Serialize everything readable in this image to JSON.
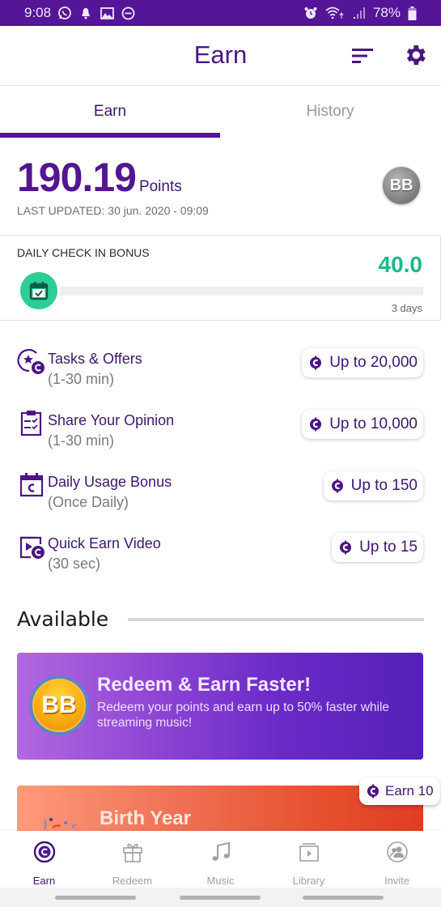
{
  "status_bar": {
    "time": "9:08",
    "battery": "78%",
    "left_icons": [
      "whatsapp-icon",
      "notification-bell-icon",
      "gallery-icon",
      "do-not-disturb-icon"
    ],
    "right_icons": [
      "alarm-icon",
      "wifi-icon",
      "signal-icon",
      "battery-icon"
    ]
  },
  "header": {
    "title": "Earn",
    "actions": [
      "filter-icon",
      "settings-gear-icon"
    ]
  },
  "tabs": [
    {
      "label": "Earn",
      "active": true
    },
    {
      "label": "History",
      "active": false
    }
  ],
  "points": {
    "value": "190.19",
    "unit": "Points",
    "last_updated": "LAST UPDATED: 30 jun. 2020 - 09:09",
    "badge": "BB"
  },
  "daily_check_in": {
    "label": "DAILY CHECK IN BONUS",
    "amount": "40.0",
    "days": "3 days",
    "progress_fraction": 0
  },
  "earn_items": [
    {
      "name": "Tasks & Offers",
      "sub": "(1-30 min)",
      "reward": "Up to 20,000",
      "icon": "tasks-offers-icon"
    },
    {
      "name": "Share Your Opinion",
      "sub": "(1-30 min)",
      "reward": "Up to 10,000",
      "icon": "survey-clipboard-icon"
    },
    {
      "name": "Daily Usage Bonus",
      "sub": "(Once Daily)",
      "reward": "Up to 150",
      "icon": "calendar-coin-icon"
    },
    {
      "name": "Quick Earn Video",
      "sub": "(30 sec)",
      "reward": "Up to 15",
      "icon": "video-coin-icon"
    }
  ],
  "available": {
    "heading": "Available"
  },
  "promo": {
    "badge": "BB",
    "title": "Redeem & Earn Faster!",
    "description": "Redeem your points and earn up to 50% faster while streaming music!"
  },
  "birth_year": {
    "title": "Birth Year",
    "reward": "Earn 10"
  },
  "bottom_nav": [
    {
      "label": "Earn",
      "active": true
    },
    {
      "label": "Redeem",
      "active": false
    },
    {
      "label": "Music",
      "active": false
    },
    {
      "label": "Library",
      "active": false
    },
    {
      "label": "Invite",
      "active": false
    }
  ],
  "colors": {
    "brand_purple": "#541596",
    "text_purple": "#3d1670",
    "accent_green": "#2dcd95",
    "amount_green": "#1eb88a"
  }
}
